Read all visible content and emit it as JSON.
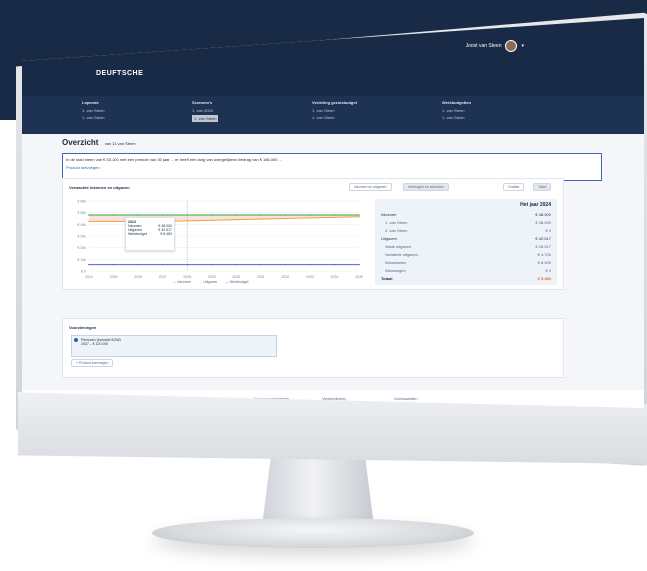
{
  "app": {
    "logo": "DEUFTSCHE",
    "user_name": "Joost van Steen"
  },
  "nav": [
    {
      "heading": "Lopende",
      "items": [
        "1. van Steen",
        "1. van Steen"
      ]
    },
    {
      "heading": "Scenario’s",
      "items": [
        "1. van 2024",
        "1. van Steen"
      ]
    },
    {
      "heading": "Verdeling gezinsbudget",
      "items": [
        "1. van Steen",
        "1. van Steen"
      ]
    },
    {
      "heading": "Werkbudgetten",
      "items": [
        "1. van Steen",
        "1. van Steen"
      ]
    }
  ],
  "overview": {
    "title": "Overzicht",
    "subtitle": "van 11 van Steen",
    "notice": "In de stad steen van € 53.100 met een periode van 30 jaar ... er heeft een lang van overgelijkend bedrag van € 186.000 ...",
    "notice_link": "Product toevoegen"
  },
  "chart_card": {
    "title": "Verwachte inkomen en uitgaven",
    "tabs": [
      "Inkomen en uitgaven",
      "Vermogen en schulden"
    ],
    "toggle": [
      "Grafiek",
      "Tabel"
    ],
    "legend": [
      "Inkomen",
      "Uitgaven",
      "Werkbudget"
    ],
    "tooltip": {
      "year": "2024",
      "rows": [
        {
          "label": "Inkomen",
          "value": "€ 48.000"
        },
        {
          "label": "Uitgaven",
          "value": "€ 42.517"
        },
        {
          "label": "Werkbudget",
          "value": "€ 5.483"
        }
      ]
    }
  },
  "chart_data": {
    "type": "line",
    "x": [
      "2024",
      "2025",
      "2026",
      "2027",
      "2028",
      "2029",
      "2030",
      "2031",
      "2032",
      "2033",
      "2034",
      "2035"
    ],
    "y_ticks": [
      "€ 0",
      "€ 10k",
      "€ 20k",
      "€ 30k",
      "€ 40k",
      "€ 50k",
      "€ 60k"
    ],
    "ylim": [
      0,
      60000
    ],
    "series": [
      {
        "name": "Inkomen",
        "color": "#28a745",
        "values": [
          48000,
          48000,
          48000,
          48000,
          48000,
          48000,
          48000,
          48000,
          48000,
          48000,
          48000,
          48000
        ]
      },
      {
        "name": "Uitgaven",
        "color": "#f0a23a",
        "values": [
          42517,
          42517,
          42517,
          42517,
          43000,
          43500,
          44000,
          44500,
          45000,
          45500,
          46000,
          46500
        ]
      },
      {
        "name": "Werkbudget",
        "color": "#5160d6",
        "values": [
          5483,
          5483,
          5483,
          5483,
          5483,
          5483,
          5483,
          5483,
          5483,
          5483,
          5483,
          5483
        ]
      }
    ]
  },
  "summary": {
    "title": "Het jaar 2024",
    "income_label": "Inkomen",
    "income_total": "€ 48.000",
    "income_rows": [
      {
        "label": "1. van Steen",
        "value": "€ 48.000"
      },
      {
        "label": "2. van Steen",
        "value": "€ 0"
      }
    ],
    "expense_label": "Uitgaven",
    "expense_total": "€ 42.517",
    "expense_rows": [
      {
        "label": "Vaste uitgaven",
        "value": "€ 28.917"
      },
      {
        "label": "Variabele uitgaven",
        "value": "€ 4.700"
      },
      {
        "label": "Woonlasten",
        "value": "€ 8.900"
      },
      {
        "label": "Aflossingen",
        "value": "€ 0"
      }
    ],
    "total_label": "Totaal",
    "total_value": "€ 5.483"
  },
  "products": {
    "title": "Voorzieningen",
    "item_title": "Pensioen (inclusief AOW)",
    "item_amount": "2027 – € 120.000",
    "add_label": "+ Product toevoegen"
  },
  "footer": [
    "Wettelijkheden",
    "Waarom verbeteren",
    "Vermindering",
    "Voorwaarden"
  ]
}
